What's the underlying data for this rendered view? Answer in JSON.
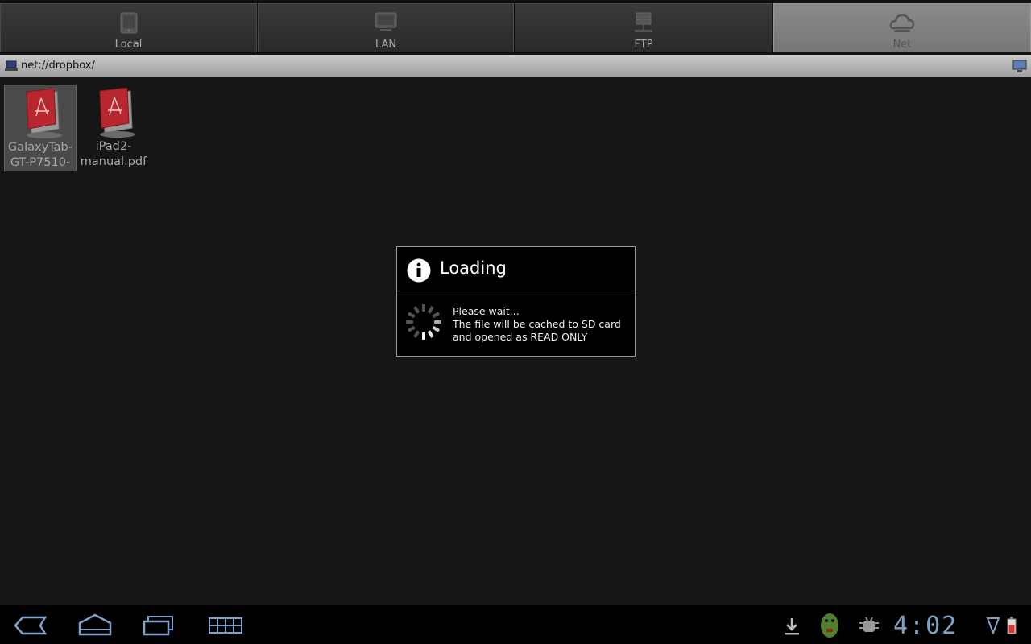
{
  "tabs": [
    {
      "label": "Local",
      "icon": "tablet-icon"
    },
    {
      "label": "LAN",
      "icon": "monitor-icon"
    },
    {
      "label": "FTP",
      "icon": "server-icon"
    },
    {
      "label": "Net",
      "icon": "cloud-icon",
      "active": true
    }
  ],
  "path": {
    "text": "net://dropbox/"
  },
  "files": [
    {
      "name": "GalaxyTab-\nGT-P7510-",
      "icon": "pdf-file-icon",
      "selected": true
    },
    {
      "name": "iPad2-\nmanual.pdf",
      "icon": "pdf-file-icon",
      "selected": false
    }
  ],
  "dialog": {
    "title": "Loading",
    "line1": "Please wait...",
    "line2": "The file will be cached to SD card",
    "line3": "and opened as READ ONLY"
  },
  "status": {
    "time": "4:02"
  },
  "colors": {
    "accent": "#7fa2c8",
    "pdf_red": "#b8262e"
  }
}
